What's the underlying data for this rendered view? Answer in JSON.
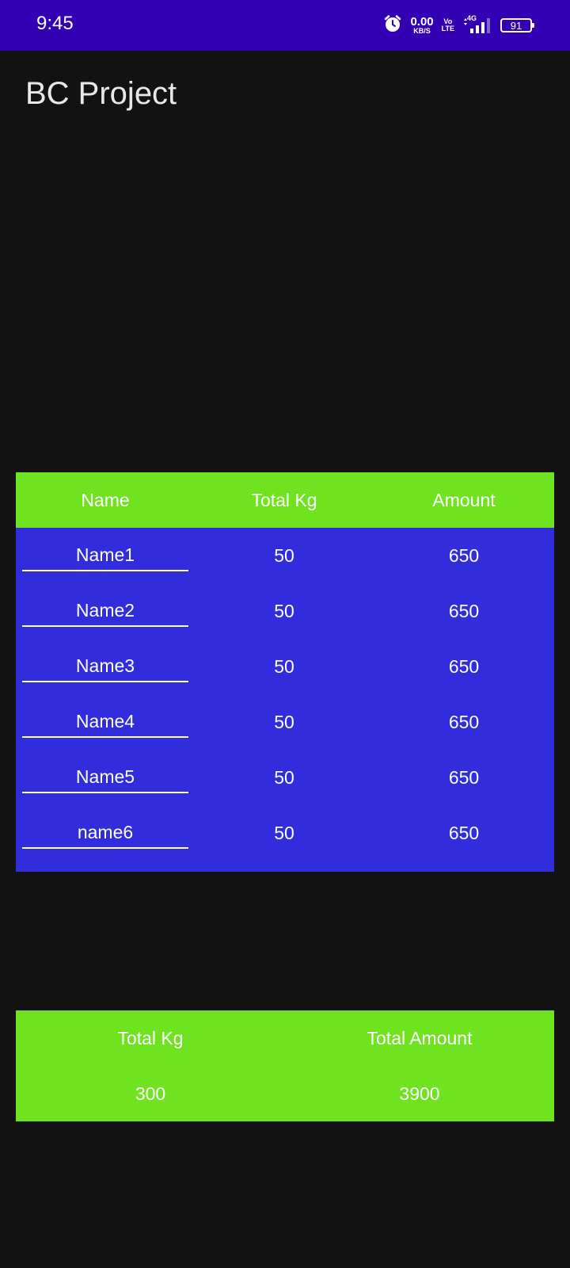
{
  "status_bar": {
    "time": "9:45",
    "net_speed_value": "0.00",
    "net_speed_unit": "KB/S",
    "volte_top": "Vo",
    "volte_bottom": "LTE",
    "network_type": "4G",
    "battery_level": "91",
    "icons": [
      "alarm-icon",
      "signal-icon",
      "battery-icon"
    ]
  },
  "app": {
    "title": "BC Project"
  },
  "table": {
    "headers": {
      "name": "Name",
      "total_kg": "Total Kg",
      "amount": "Amount"
    },
    "rows": [
      {
        "name": "Name1",
        "kg": "50",
        "amount": "650"
      },
      {
        "name": "Name2",
        "kg": "50",
        "amount": "650"
      },
      {
        "name": "Name3",
        "kg": "50",
        "amount": "650"
      },
      {
        "name": "Name4",
        "kg": "50",
        "amount": "650"
      },
      {
        "name": "Name5",
        "kg": "50",
        "amount": "650"
      },
      {
        "name": "name6",
        "kg": "50",
        "amount": "650"
      }
    ]
  },
  "totals": {
    "kg_label": "Total Kg",
    "amount_label": "Total Amount",
    "kg_value": "300",
    "amount_value": "3900"
  },
  "colors": {
    "status_bar": "#3300b3",
    "background": "#121212",
    "header_green": "#70e320",
    "table_blue": "#312cdc",
    "text": "#ffffff"
  }
}
